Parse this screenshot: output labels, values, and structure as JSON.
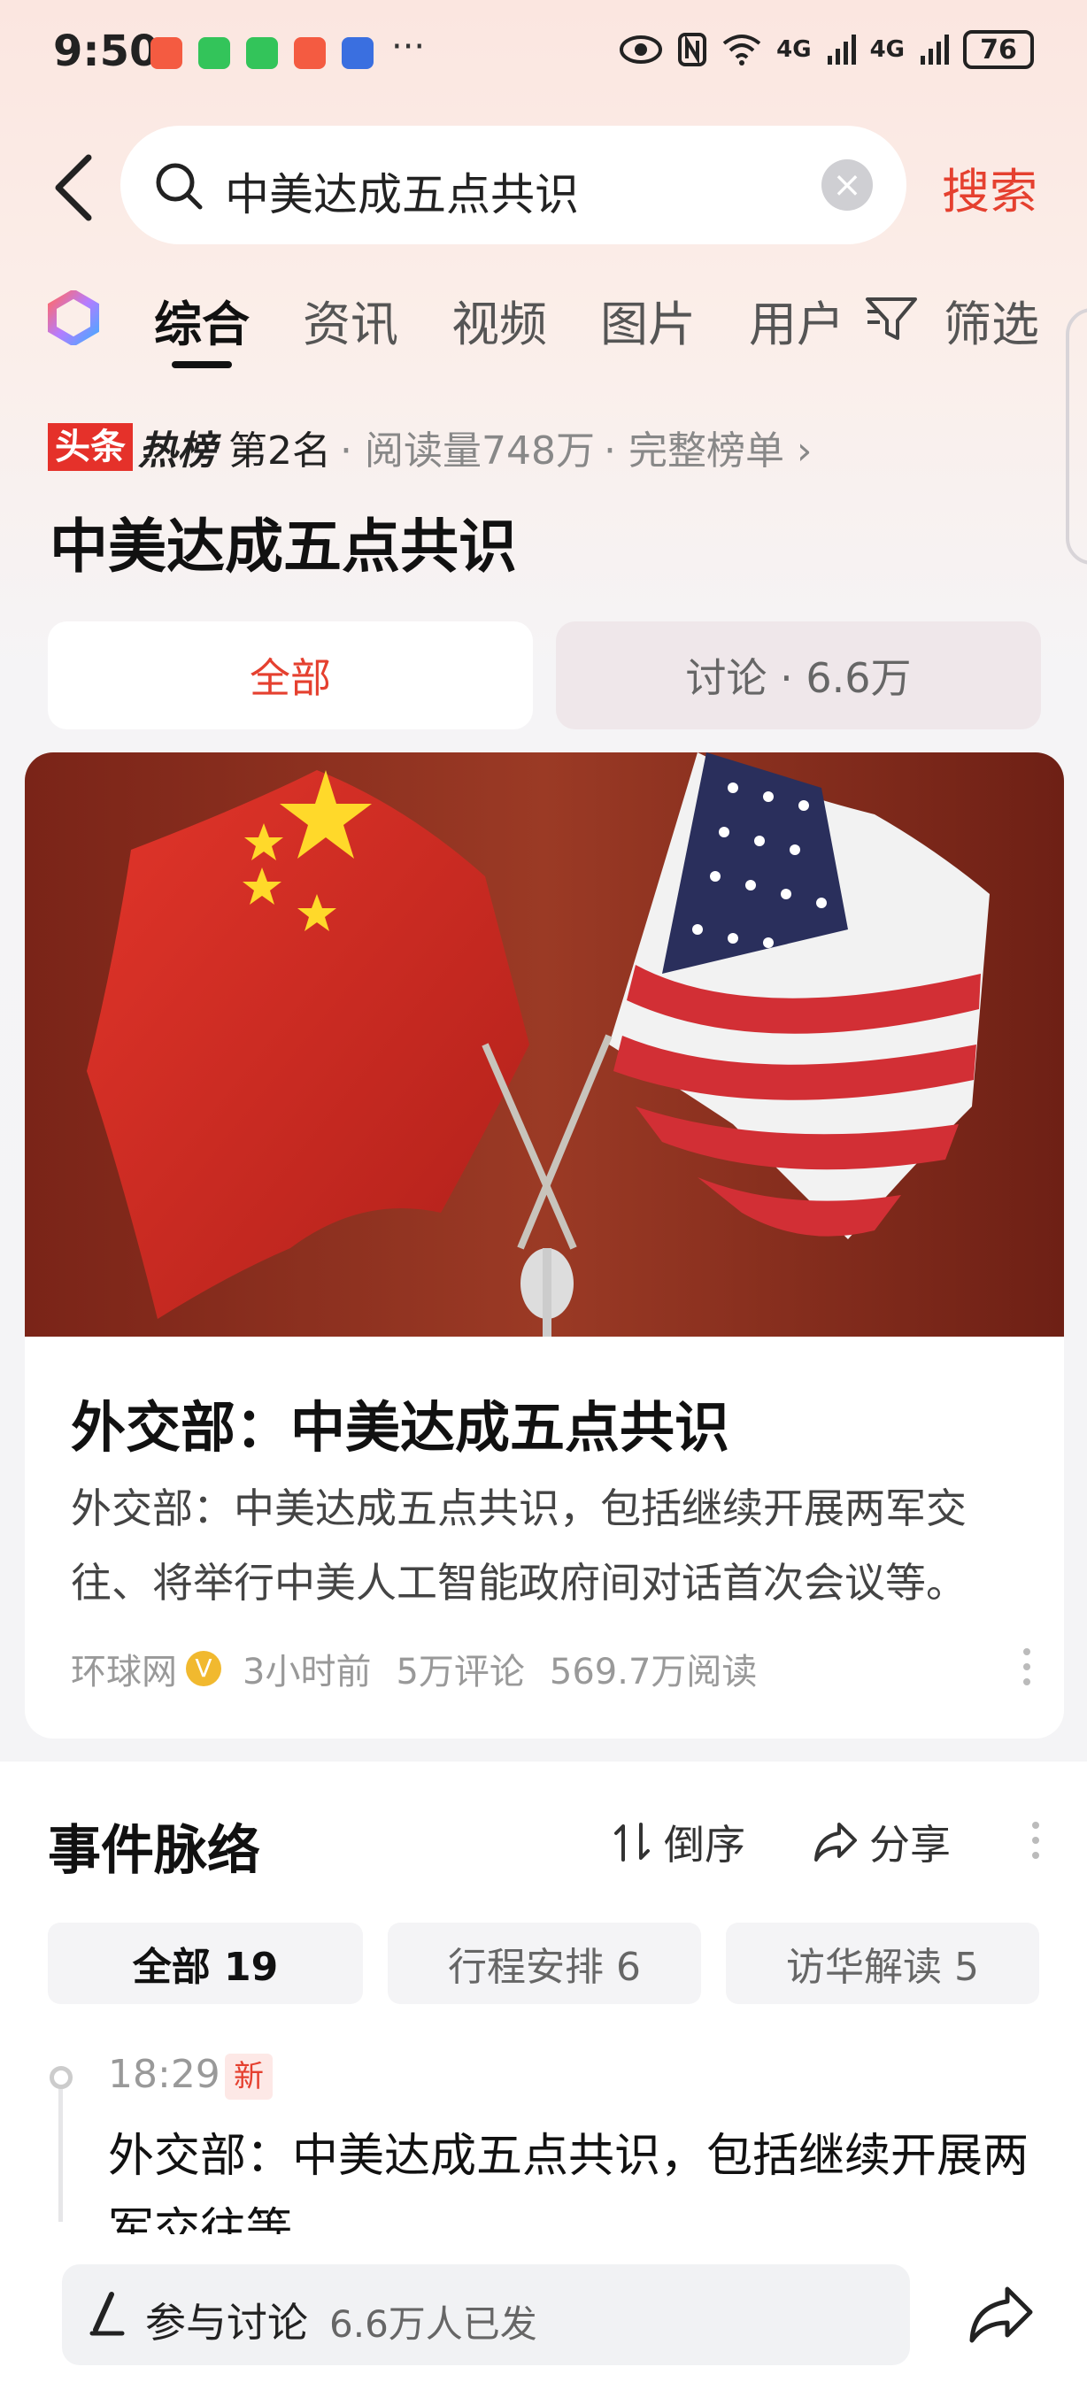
{
  "status_bar": {
    "time": "9:50",
    "more": "···",
    "network": "4G",
    "network2": "4G",
    "battery": "76"
  },
  "search": {
    "query": "中美达成五点共识",
    "button_label": "搜索"
  },
  "tabs": [
    {
      "label": "综合",
      "active": true
    },
    {
      "label": "资讯",
      "active": false
    },
    {
      "label": "视频",
      "active": false
    },
    {
      "label": "图片",
      "active": false
    },
    {
      "label": "用户",
      "active": false
    }
  ],
  "filter_label": "筛选",
  "hot": {
    "badge": "头条",
    "word": "热榜",
    "rank": "第2名",
    "reads": "· 阅读量748万",
    "full_list": "· 完整榜单 ›"
  },
  "topic_title": "中美达成五点共识",
  "segments": {
    "all": "全部",
    "discuss": "讨论 · 6.6万"
  },
  "news": {
    "title": "外交部：中美达成五点共识",
    "summary": "外交部：中美达成五点共识，包括继续开展两军交往、将举行中美人工智能政府间对话首次会议等。",
    "source": "环球网",
    "time": "3小时前",
    "comments": "5万评论",
    "reads": "569.7万阅读"
  },
  "timeline": {
    "title": "事件脉络",
    "sort_label": "倒序",
    "share_label": "分享",
    "chips": [
      {
        "label": "全部 19",
        "active": true
      },
      {
        "label": "行程安排 6",
        "active": false
      },
      {
        "label": "访华解读 5",
        "active": false
      }
    ],
    "item": {
      "time": "18:29",
      "badge": "新",
      "text": "外交部：中美达成五点共识，包括继续开展两军交往等"
    }
  },
  "bottom": {
    "discuss_label": "参与讨论",
    "discuss_count": "6.6万人已发"
  },
  "colors": {
    "accent": "#e5402f",
    "hot_badge": "#e5312a"
  }
}
